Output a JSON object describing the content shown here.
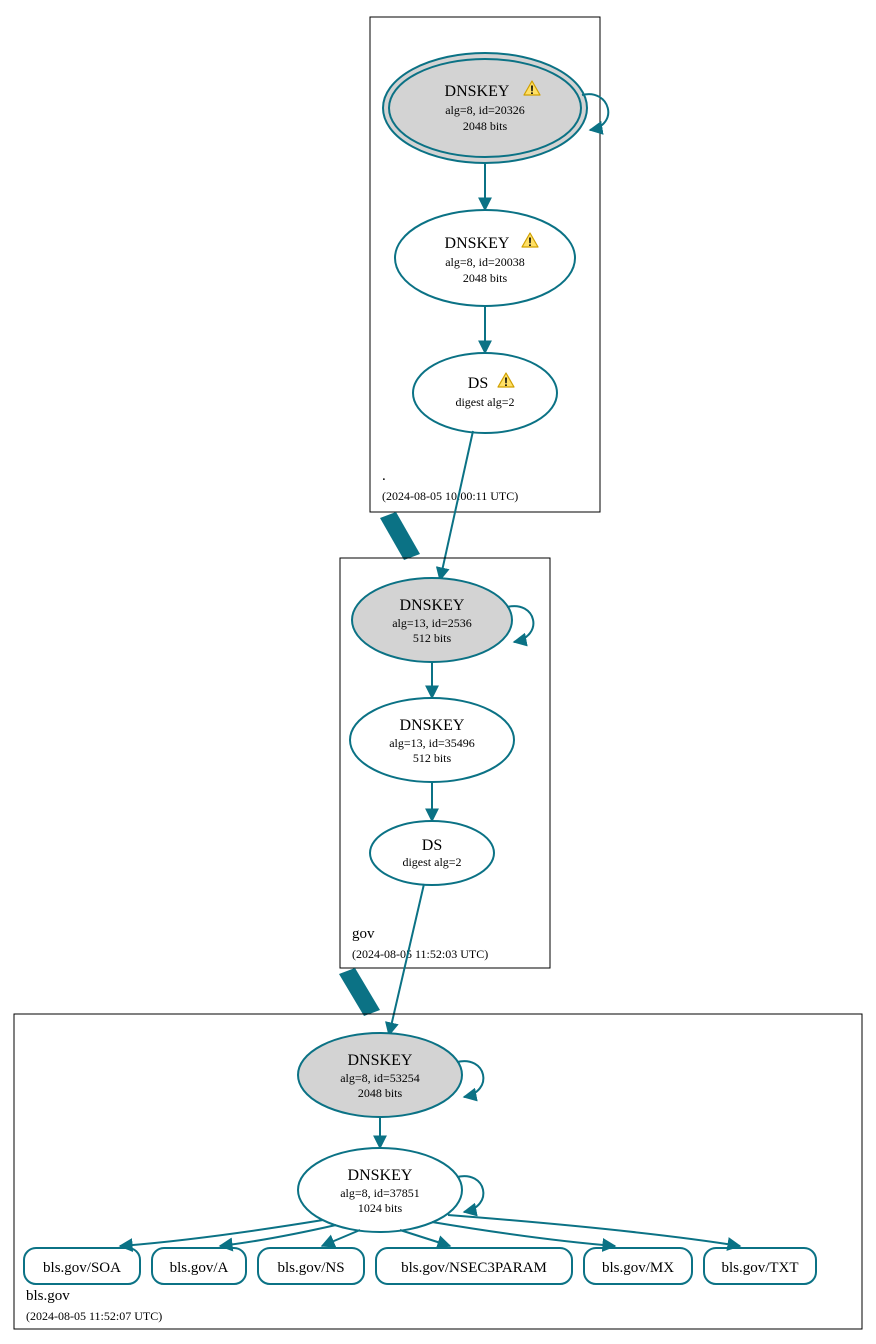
{
  "zones": {
    "root": {
      "name": ".",
      "ts": "(2024-08-05 10:00:11 UTC)",
      "ksk": {
        "title": "DNSKEY",
        "meta": "alg=8, id=20326",
        "bits": "2048 bits",
        "warn": true
      },
      "zsk": {
        "title": "DNSKEY",
        "meta": "alg=8, id=20038",
        "bits": "2048 bits",
        "warn": true
      },
      "ds": {
        "title": "DS",
        "meta": "digest alg=2",
        "warn": true
      }
    },
    "gov": {
      "name": "gov",
      "ts": "(2024-08-05 11:52:03 UTC)",
      "ksk": {
        "title": "DNSKEY",
        "meta": "alg=13, id=2536",
        "bits": "512 bits"
      },
      "zsk": {
        "title": "DNSKEY",
        "meta": "alg=13, id=35496",
        "bits": "512 bits"
      },
      "ds": {
        "title": "DS",
        "meta": "digest alg=2"
      }
    },
    "bls": {
      "name": "bls.gov",
      "ts": "(2024-08-05 11:52:07 UTC)",
      "ksk": {
        "title": "DNSKEY",
        "meta": "alg=8, id=53254",
        "bits": "2048 bits"
      },
      "zsk": {
        "title": "DNSKEY",
        "meta": "alg=8, id=37851",
        "bits": "1024 bits"
      }
    }
  },
  "rrsets": {
    "soa": "bls.gov/SOA",
    "a": "bls.gov/A",
    "ns": "bls.gov/NS",
    "nsec3p": "bls.gov/NSEC3PARAM",
    "mx": "bls.gov/MX",
    "txt": "bls.gov/TXT"
  }
}
